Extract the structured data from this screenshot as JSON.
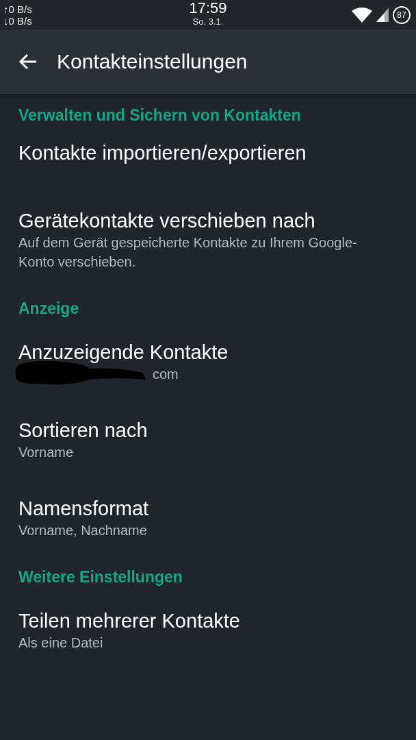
{
  "status_bar": {
    "net_up": "↑0 B/s",
    "net_down": "↓0 B/s",
    "time": "17:59",
    "date": "So. 3.1.",
    "battery": "87"
  },
  "toolbar": {
    "title": "Kontakteinstellungen"
  },
  "settings": [
    {
      "kind": "header",
      "title": "Verwalten und Sichern von Kontakten"
    },
    {
      "kind": "item",
      "title": "Kontakte importieren/exportieren"
    },
    {
      "kind": "item",
      "title": "Gerätekontakte verschieben nach",
      "summary": "Auf dem Gerät gespeicherte Kontakte zu Ihrem Google-Konto verschieben."
    },
    {
      "kind": "header",
      "title": "Anzeige"
    },
    {
      "kind": "item",
      "title": "Anzuzeigende Kontakte",
      "summary": "com",
      "redacted": true
    },
    {
      "kind": "item",
      "title": "Sortieren nach",
      "summary": "Vorname"
    },
    {
      "kind": "item",
      "title": "Namensformat",
      "summary": "Vorname, Nachname"
    },
    {
      "kind": "header",
      "title": "Weitere Einstellungen"
    },
    {
      "kind": "item",
      "title": "Teilen mehrerer Kontakte",
      "summary": "Als eine Datei"
    }
  ]
}
